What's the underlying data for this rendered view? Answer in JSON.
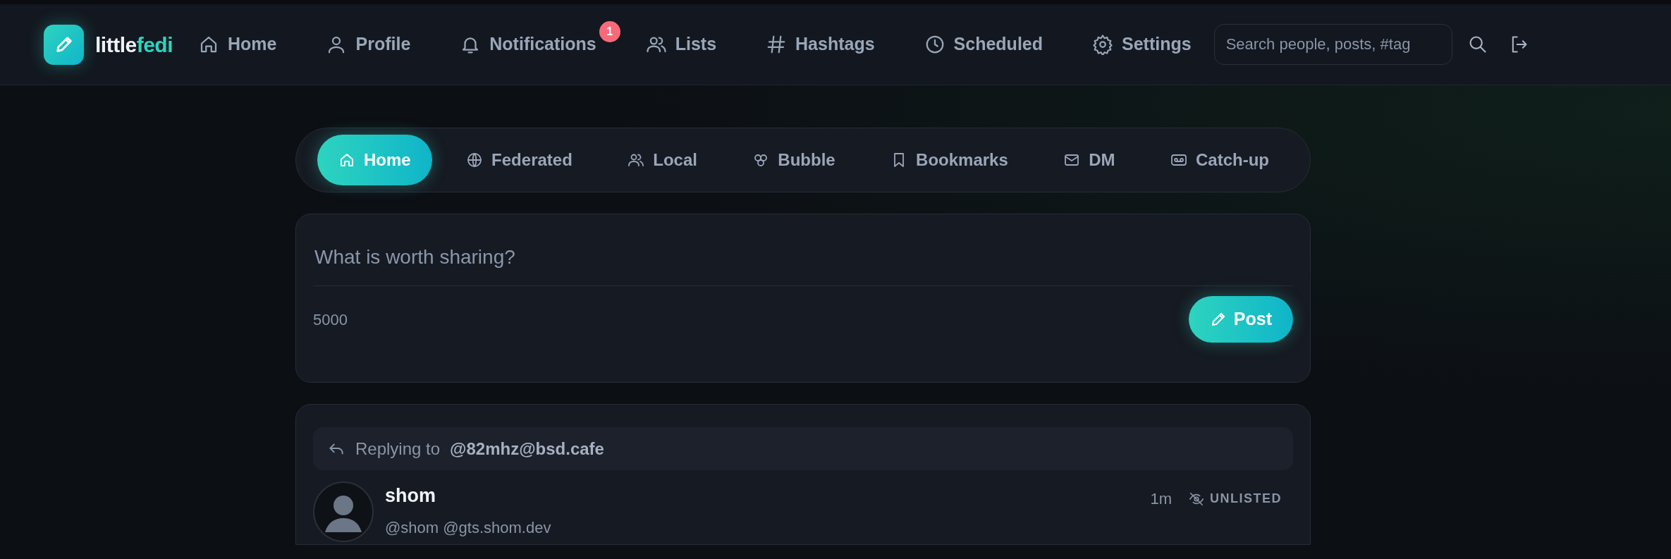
{
  "brand": {
    "parts": [
      {
        "text": "little",
        "accent": false
      },
      {
        "text": "fedi",
        "accent": true
      }
    ]
  },
  "nav": [
    {
      "label": "Home"
    },
    {
      "label": "Profile"
    },
    {
      "label": "Notifications",
      "badge": "1"
    },
    {
      "label": "Lists"
    },
    {
      "label": "Hashtags"
    },
    {
      "label": "Scheduled"
    },
    {
      "label": "Settings"
    }
  ],
  "search": {
    "placeholder": "Search people, posts, #tag"
  },
  "timeline_tabs": [
    {
      "label": "Home",
      "selected": true
    },
    {
      "label": "Federated",
      "selected": false
    },
    {
      "label": "Local",
      "selected": false
    },
    {
      "label": "Bubble",
      "selected": false
    },
    {
      "label": "Bookmarks",
      "selected": false
    },
    {
      "label": "DM",
      "selected": false
    },
    {
      "label": "Catch-up",
      "selected": false
    }
  ],
  "composer": {
    "placeholder": "What is worth sharing?",
    "counter": "5000",
    "button": "Post"
  },
  "post": {
    "reply_prefix": "Replying to",
    "reply_to": "@82mhz@bsd.cafe",
    "name": "shom",
    "handle": "@shom @gts.shom.dev",
    "time": "1m",
    "visibility": "UNLISTED"
  }
}
